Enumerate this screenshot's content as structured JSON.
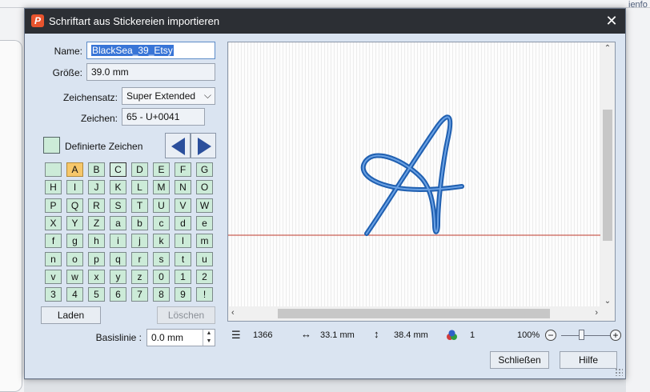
{
  "background": {
    "right_text": "ienfo"
  },
  "dialog": {
    "title": "Schriftart aus Stickereien importieren",
    "name_label": "Name:",
    "name_value": "BlackSea_39_Etsy",
    "size_label": "Größe:",
    "size_value": "39.0 mm",
    "charset_label": "Zeichensatz:",
    "charset_value": "Super Extended",
    "char_label": "Zeichen:",
    "char_value": "65 - U+0041",
    "defined_label": "Definierte Zeichen",
    "characters": [
      "",
      "A",
      "B",
      "C",
      "D",
      "E",
      "F",
      "G",
      "H",
      "I",
      "J",
      "K",
      "L",
      "M",
      "N",
      "O",
      "P",
      "Q",
      "R",
      "S",
      "T",
      "U",
      "V",
      "W",
      "X",
      "Y",
      "Z",
      "a",
      "b",
      "c",
      "d",
      "e",
      "f",
      "g",
      "h",
      "i",
      "j",
      "k",
      "l",
      "m",
      "n",
      "o",
      "p",
      "q",
      "r",
      "s",
      "t",
      "u",
      "v",
      "w",
      "x",
      "y",
      "z",
      "0",
      "1",
      "2",
      "3",
      "4",
      "5",
      "6",
      "7",
      "8",
      "9",
      "!"
    ],
    "selected_char": "A",
    "load_button": "Laden",
    "delete_button": "Löschen",
    "baseline_label": "Basislinie :",
    "baseline_value": "0.0 mm",
    "status": {
      "stitches": "1366",
      "width": "33.1 mm",
      "height": "38.4 mm",
      "colors": "1",
      "zoom": "100%",
      "zoom_level": 0.4
    },
    "close_button": "Schließen",
    "help_button": "Hilfe",
    "colors": {
      "stroke": "#2f6fc4",
      "baseline": "#c0392b",
      "selected": "#f6c76a",
      "cell": "#ccebd8"
    }
  }
}
